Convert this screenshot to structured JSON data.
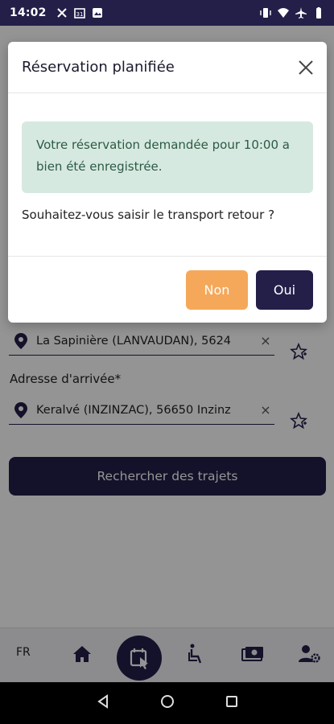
{
  "status_bar": {
    "time": "14:02",
    "left_icons": [
      "cross-arrows-icon",
      "calendar-icon",
      "image-icon"
    ],
    "right_icons": [
      "vibrate-icon",
      "wifi-icon",
      "airplane-icon",
      "battery-icon"
    ]
  },
  "form": {
    "departure_value": "La Sapinière (LANVAUDAN), 5624",
    "arrival_label": "Adresse d'arrivée*",
    "arrival_value": "Keralvé (INZINZAC), 56650 Inzinz",
    "clear_glyph": "×",
    "search_button": "Rechercher des trajets"
  },
  "bottom_nav": {
    "lang": "FR",
    "items": [
      "home-icon",
      "booking-icon",
      "wheelchair-icon",
      "money-icon",
      "user-settings-icon"
    ],
    "active": "booking-icon"
  },
  "dialog": {
    "title": "Réservation planifiée",
    "close_glyph": "×",
    "alert_text": "Votre réservation demandée pour 10:00 a bien été enregistrée.",
    "question": "Souhaitez-vous saisir le transport retour ?",
    "btn_no": "Non",
    "btn_yes": "Oui"
  },
  "colors": {
    "primary": "#231f49",
    "secondary": "#f5a85a",
    "success_bg": "#d6e9e0",
    "success_text": "#2d5a45"
  }
}
